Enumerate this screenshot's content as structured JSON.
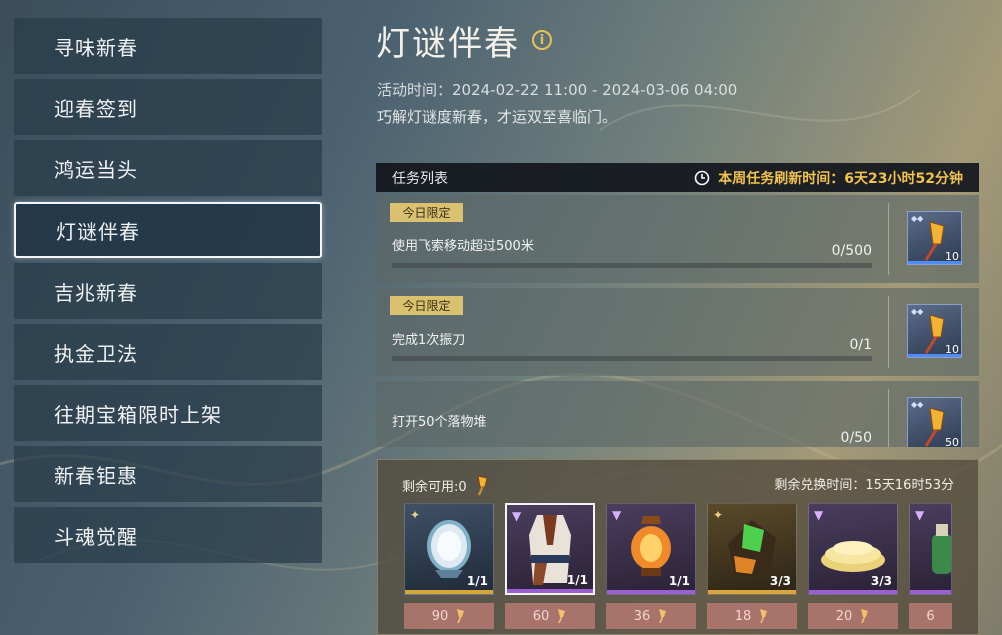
{
  "sidebar": {
    "items": [
      {
        "label": "寻味新春",
        "active": false
      },
      {
        "label": "迎春签到",
        "active": false
      },
      {
        "label": "鸿运当头",
        "active": false
      },
      {
        "label": "灯谜伴春",
        "active": true
      },
      {
        "label": "吉兆新春",
        "active": false
      },
      {
        "label": "执金卫法",
        "active": false
      },
      {
        "label": "往期宝箱限时上架",
        "active": false
      },
      {
        "label": "新春钜惠",
        "active": false
      },
      {
        "label": "斗魂觉醒",
        "active": false
      }
    ]
  },
  "header": {
    "title": "灯谜伴春",
    "info_icon_glyph": "i",
    "event_time": "活动时间：2024-02-22 11:00 - 2024-03-06 04:00",
    "description": "巧解灯谜度新春，才运双至喜临门。"
  },
  "tasks": {
    "header_title": "任务列表",
    "refresh_label": "本周任务刷新时间：6天23小时52分钟",
    "rows": [
      {
        "tag": "今日限定",
        "text": "使用飞索移动超过500米",
        "progress": "0/500",
        "reward_count": "10"
      },
      {
        "tag": "今日限定",
        "text": "完成1次振刀",
        "progress": "0/1",
        "reward_count": "10"
      },
      {
        "tag": "",
        "text": "打开50个落物堆",
        "progress": "0/50",
        "reward_count": "50"
      }
    ]
  },
  "exchange": {
    "remaining_label": "剩余可用:0",
    "time_label": "剩余兑换时间：15天16时53分",
    "items": [
      {
        "icon": "mirror-icon",
        "rarity": "gold",
        "count": "1/1",
        "price": "90",
        "selected": false,
        "bar_color": "#d8a63a"
      },
      {
        "icon": "outfit-icon",
        "rarity": "purple",
        "count": "1/1",
        "price": "60",
        "selected": true,
        "bar_color": "#9a5fd0"
      },
      {
        "icon": "lantern-icon",
        "rarity": "purple",
        "count": "1/1",
        "price": "36",
        "selected": false,
        "bar_color": "#9a5fd0"
      },
      {
        "icon": "gem-ore-icon",
        "rarity": "gold",
        "count": "3/3",
        "price": "18",
        "selected": false,
        "bar_color": "#d8a63a"
      },
      {
        "icon": "cake-icon",
        "rarity": "purple",
        "count": "3/3",
        "price": "20",
        "selected": false,
        "bar_color": "#9a5fd0"
      },
      {
        "icon": "bottle-icon",
        "rarity": "purple",
        "count": "",
        "price": "6",
        "selected": false,
        "bar_color": "#9a5fd0"
      }
    ]
  },
  "colors": {
    "accent_gold": "#f0c24e",
    "tag_bg": "#d9c170",
    "price_bg": "#a8736a",
    "rarity_gold": "#d8a63a",
    "rarity_purple": "#9a5fd0"
  }
}
